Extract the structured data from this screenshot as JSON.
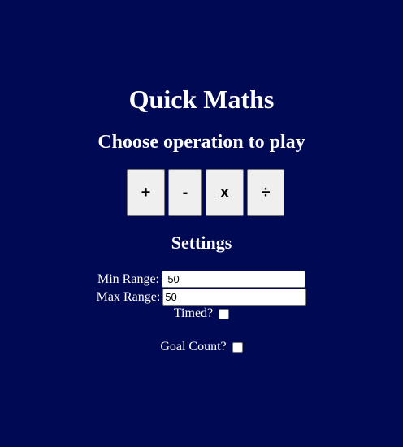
{
  "header": {
    "title": "Quick Maths",
    "subtitle": "Choose operation to play"
  },
  "operations": [
    {
      "label": "+"
    },
    {
      "label": "-"
    },
    {
      "label": "x"
    },
    {
      "label": "÷"
    }
  ],
  "settings": {
    "heading": "Settings",
    "min_range": {
      "label": "Min Range:",
      "value": "-50"
    },
    "max_range": {
      "label": "Max Range:",
      "value": "50"
    },
    "timed": {
      "label": "Timed?",
      "checked": false
    },
    "goal_count": {
      "label": "Goal Count?",
      "checked": false
    }
  },
  "colors": {
    "background": "#000954",
    "text": "#ffffff",
    "button_bg": "#efefef"
  }
}
